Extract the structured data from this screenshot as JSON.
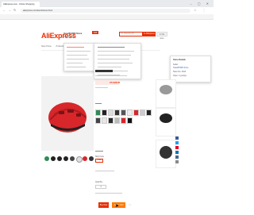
{
  "browser": {
    "tab_title": "AliExpress.com - Online Shopping",
    "url": "aliexpress.com/item/helmet.html",
    "nav_back": "←",
    "nav_forward": "→",
    "nav_reload": "↻",
    "window_buttons": "– ▢ ✕"
  },
  "header": {
    "logo": "AliExpress",
    "store_name": "HeadFHNDI Store",
    "store_badge": "TOP",
    "store_sub": "Add to Store",
    "search_placeholder": "I'm shopping for...",
    "search_button": "In AliExpress",
    "store_search_button": "In this store"
  },
  "store_nav": {
    "items": [
      "Store Home",
      "Products",
      "Sale Items",
      "Top Selling",
      "Feedback"
    ]
  },
  "seller_popup": {
    "title": "Store Details",
    "label": "Seller:",
    "link": "HeadFHNDI Store",
    "line1": "Store No. 2013",
    "line2": "Open: 4 year(s)"
  },
  "product": {
    "price": "US $28.65",
    "shipping_label": "Ship From",
    "ship_option": "China",
    "qty_label": "Quantity",
    "qty_value": "1",
    "buy_now": "Buy Now",
    "add_to_cart": "Add to Cart",
    "wish_icon": "heart-icon"
  },
  "colors": {
    "accent": "#e62e04",
    "cart": "#ff7a00",
    "helmet": "#d8262a"
  }
}
